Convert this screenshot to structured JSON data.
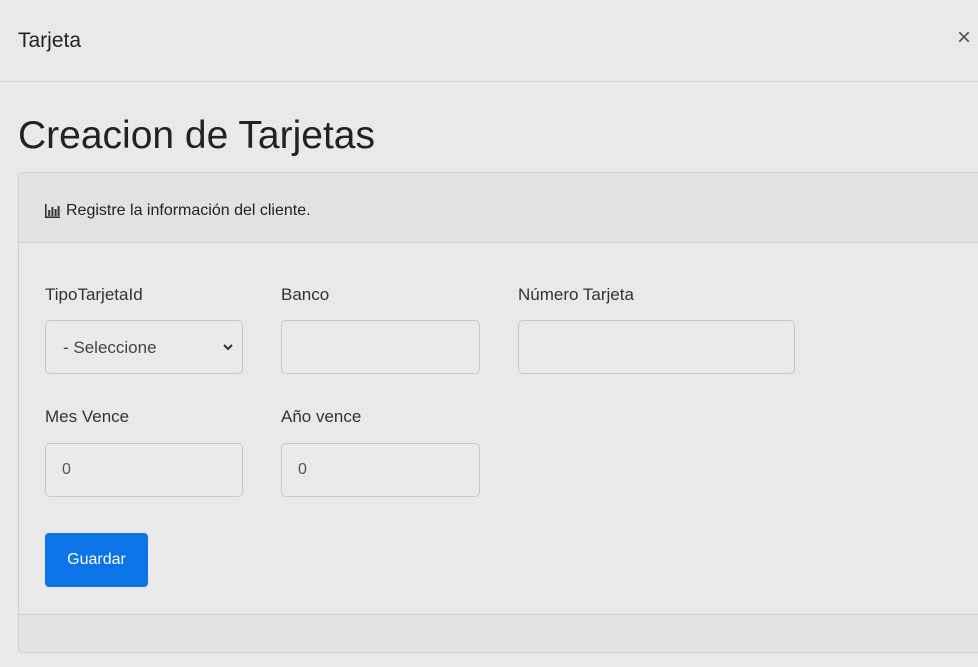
{
  "modal": {
    "title": "Tarjeta",
    "close_glyph": "×"
  },
  "page": {
    "title": "Creacion de Tarjetas"
  },
  "card": {
    "header_icon": "bar-chart-icon",
    "header_text": "Registre la información del cliente."
  },
  "form": {
    "tipo_tarjeta": {
      "label": "TipoTarjetaId",
      "selected": "- Seleccione"
    },
    "banco": {
      "label": "Banco",
      "value": ""
    },
    "numero_tarjeta": {
      "label": "Número Tarjeta",
      "value": ""
    },
    "mes_vence": {
      "label": "Mes Vence",
      "value": "0"
    },
    "anio_vence": {
      "label": "Año vence",
      "value": "0"
    },
    "submit_label": "Guardar"
  },
  "colors": {
    "primary": "#0d74e7",
    "background": "#e9e9e9",
    "card_header": "#e2e2e2"
  }
}
